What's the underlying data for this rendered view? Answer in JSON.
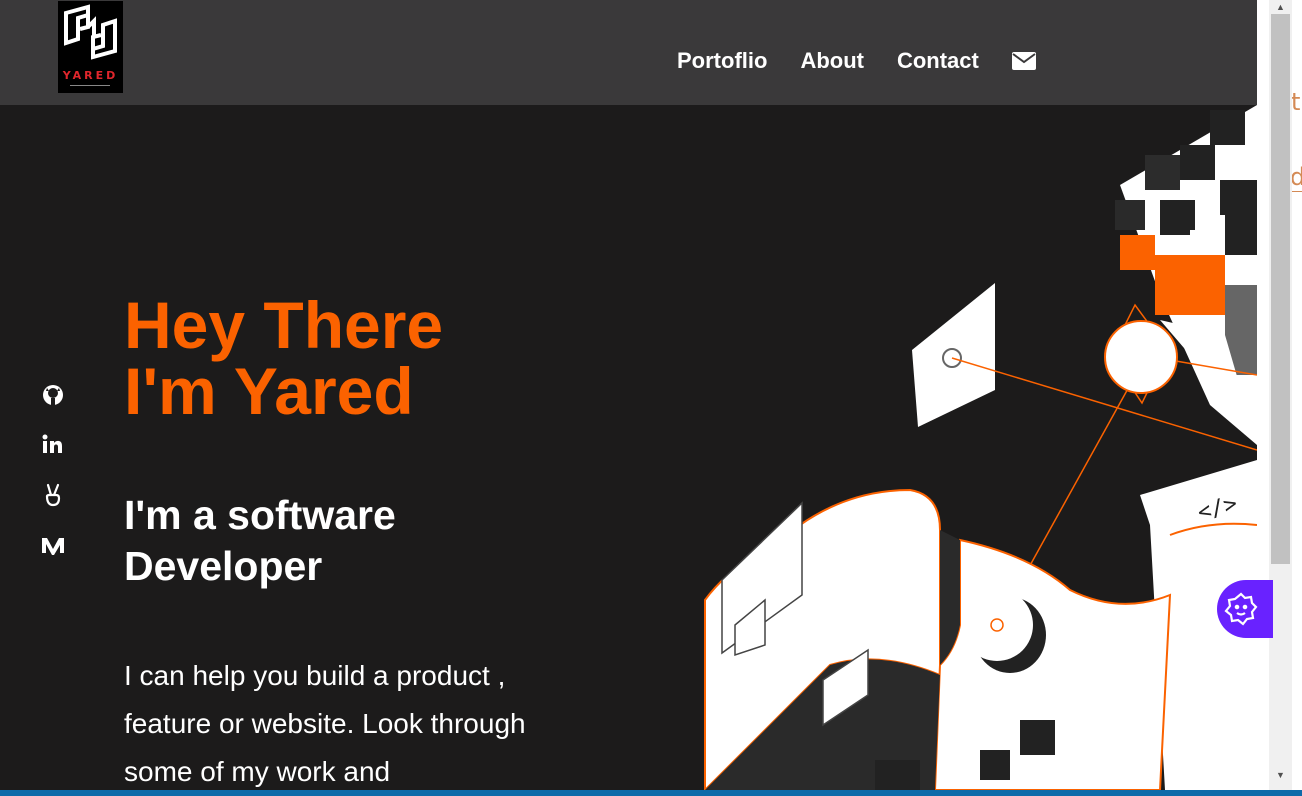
{
  "brand": {
    "logo_text": "YARED"
  },
  "nav": {
    "links": [
      "Portoflio",
      "About",
      "Contact"
    ],
    "mail_icon": "envelope-icon"
  },
  "socials": [
    {
      "icon": "github-icon"
    },
    {
      "icon": "linkedin-icon"
    },
    {
      "icon": "peace-hand-icon"
    },
    {
      "icon": "medium-icon"
    }
  ],
  "hero": {
    "title_line1": "Hey There",
    "title_line2": "I'm Yared",
    "subtitle_line1": "I'm a software",
    "subtitle_line2": "Developer",
    "description": "I can help you build a product , feature or website. Look through some of my work and"
  },
  "art": {
    "code_text": "</>"
  },
  "colors": {
    "accent": "#fb6200",
    "background": "#1c1b1b",
    "navbar": "#3a393a",
    "widget": "#6922ff",
    "logo_red": "#e0262c"
  },
  "widget": {
    "icon": "gear-face-icon"
  },
  "peek": {
    "char1": "t",
    "char2": "d"
  },
  "scrollbar": {
    "up_arrow": "▲",
    "down_arrow": "▼"
  }
}
